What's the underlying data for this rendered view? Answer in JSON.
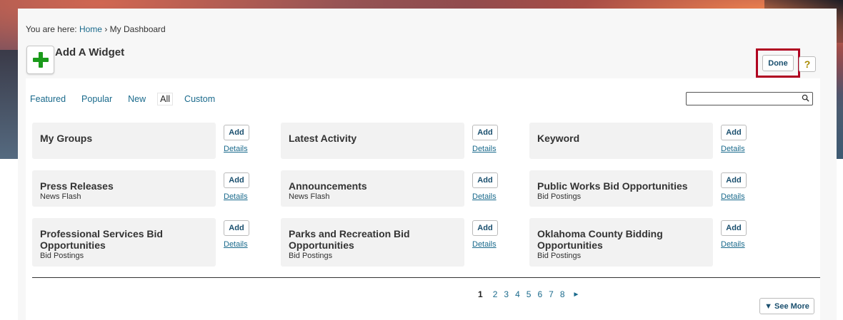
{
  "breadcrumb": {
    "prefix": "You are here:",
    "home": "Home",
    "separator": "›",
    "current": "My Dashboard"
  },
  "header": {
    "title": "Add A Widget",
    "done_label": "Done",
    "help_label": "?"
  },
  "tabs": [
    {
      "label": "Featured",
      "active": false
    },
    {
      "label": "Popular",
      "active": false
    },
    {
      "label": "New",
      "active": false
    },
    {
      "label": "All",
      "active": true
    },
    {
      "label": "Custom",
      "active": false
    }
  ],
  "search": {
    "value": "",
    "placeholder": ""
  },
  "widgets": [
    {
      "title": "My Groups",
      "subtitle": "",
      "add_label": "Add",
      "details_label": "Details"
    },
    {
      "title": "Latest Activity",
      "subtitle": "",
      "add_label": "Add",
      "details_label": "Details"
    },
    {
      "title": "Keyword",
      "subtitle": "",
      "add_label": "Add",
      "details_label": "Details"
    },
    {
      "title": "Press Releases",
      "subtitle": "News Flash",
      "add_label": "Add",
      "details_label": "Details"
    },
    {
      "title": "Announcements",
      "subtitle": "News Flash",
      "add_label": "Add",
      "details_label": "Details"
    },
    {
      "title": "Public Works Bid Opportunities",
      "subtitle": "Bid Postings",
      "add_label": "Add",
      "details_label": "Details"
    },
    {
      "title": "Professional Services Bid Opportunities",
      "subtitle": "Bid Postings",
      "add_label": "Add",
      "details_label": "Details"
    },
    {
      "title": "Parks and Recreation Bid Opportunities",
      "subtitle": "Bid Postings",
      "add_label": "Add",
      "details_label": "Details"
    },
    {
      "title": "Oklahoma County Bidding Opportunities",
      "subtitle": "Bid Postings",
      "add_label": "Add",
      "details_label": "Details"
    }
  ],
  "pagination": {
    "current": "1",
    "pages": [
      "2",
      "3",
      "4",
      "5",
      "6",
      "7",
      "8"
    ],
    "next": "►"
  },
  "see_more_label": "▼ See More",
  "colors": {
    "accent": "#1a6a8c",
    "highlight_border": "#b00020",
    "plus": "#1b9a1b"
  }
}
